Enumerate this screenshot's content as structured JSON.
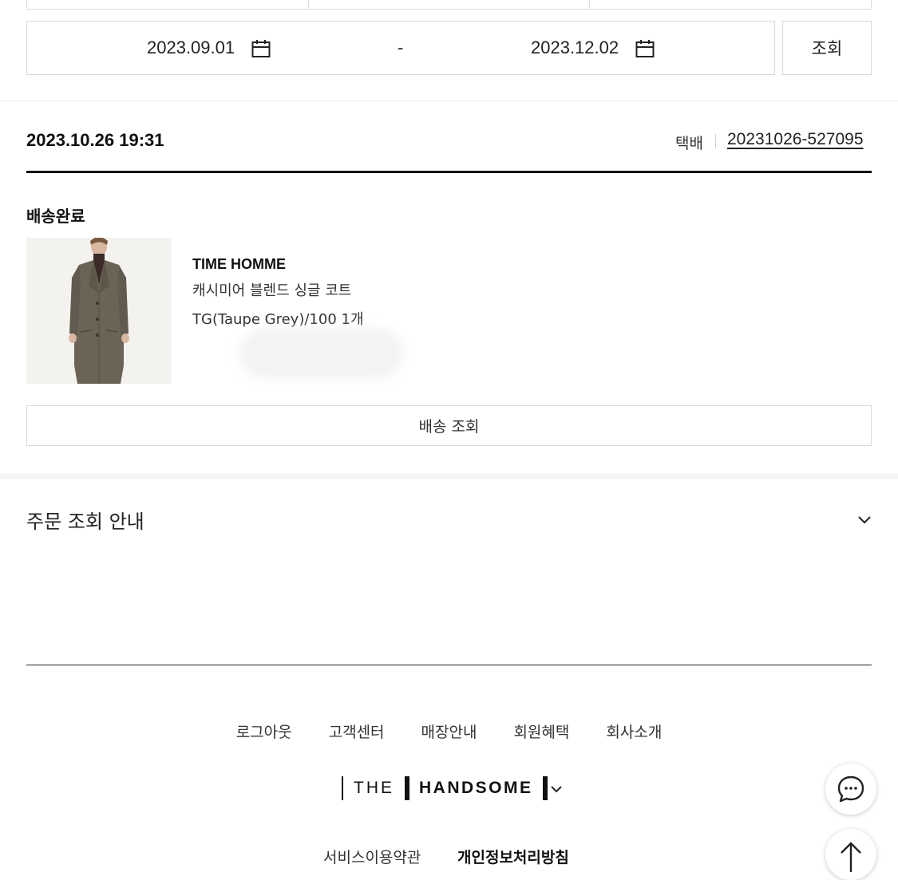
{
  "search": {
    "start_date": "2023.09.01",
    "separator": "-",
    "end_date": "2023.12.02",
    "search_label": "조회"
  },
  "order": {
    "datetime": "2023.10.26 19:31",
    "delivery_type": "택배",
    "order_number": "20231026-527095",
    "status": "배송완료",
    "item": {
      "brand": "TIME HOMME",
      "name": "캐시미어 블렌드 싱글 코트",
      "option": "TG(Taupe Grey)/100 1개"
    },
    "track_label": "배송 조회"
  },
  "guide": {
    "title": "주문 조회 안내"
  },
  "footer": {
    "links": [
      "로그아웃",
      "고객센터",
      "매장안내",
      "회원혜택",
      "회사소개"
    ],
    "logo_the": "THE",
    "logo_name": "HANDSOME",
    "policy_terms": "서비스이용약관",
    "policy_privacy": "개인정보처리방침"
  },
  "icons": {
    "calendar": "calendar-icon",
    "chevron": "chevron-down-icon",
    "chat": "chat-icon",
    "top": "arrow-up-icon"
  },
  "colors": {
    "text": "#111111",
    "border": "#d9d9d9",
    "coat": "#6b6356"
  }
}
